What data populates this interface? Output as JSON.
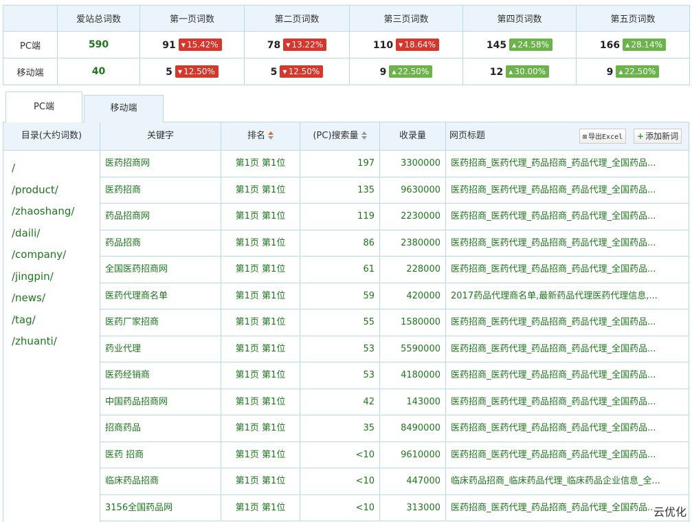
{
  "summary": {
    "headers": [
      "",
      "爱站总词数",
      "第一页词数",
      "第二页词数",
      "第三页词数",
      "第四页词数",
      "第五页词数"
    ],
    "rows": [
      {
        "label": "PC端",
        "total": "590",
        "pages": [
          {
            "count": "91",
            "change": "15.42%",
            "dir": "down"
          },
          {
            "count": "78",
            "change": "13.22%",
            "dir": "down"
          },
          {
            "count": "110",
            "change": "18.64%",
            "dir": "down"
          },
          {
            "count": "145",
            "change": "24.58%",
            "dir": "up"
          },
          {
            "count": "166",
            "change": "28.14%",
            "dir": "up"
          }
        ]
      },
      {
        "label": "移动端",
        "total": "40",
        "pages": [
          {
            "count": "5",
            "change": "12.50%",
            "dir": "down"
          },
          {
            "count": "5",
            "change": "12.50%",
            "dir": "down"
          },
          {
            "count": "9",
            "change": "22.50%",
            "dir": "up"
          },
          {
            "count": "12",
            "change": "30.00%",
            "dir": "up"
          },
          {
            "count": "9",
            "change": "22.50%",
            "dir": "up"
          }
        ]
      }
    ]
  },
  "tabs": {
    "pc": "PC端",
    "mobile": "移动端"
  },
  "table": {
    "headers": {
      "directory": "目录(大约词数)",
      "keyword": "关键字",
      "rank": "排名",
      "volume": "(PC)搜索量",
      "indexed": "收录量",
      "title": "网页标题"
    },
    "export_label": "导出Excel",
    "add_label": "添加新词",
    "directories": [
      "/",
      "/product/",
      "/zhaoshang/",
      "/daili/",
      "/company/",
      "/jingpin/",
      "/news/",
      "/tag/",
      "/zhuanti/"
    ],
    "rows": [
      {
        "keyword": "医药招商网",
        "rank": "第1页 第1位",
        "volume": "197",
        "indexed": "3300000",
        "title": "医药招商_医药代理_药品招商_药品代理_全国药品..."
      },
      {
        "keyword": "医药招商",
        "rank": "第1页 第1位",
        "volume": "135",
        "indexed": "9630000",
        "title": "医药招商_医药代理_药品招商_药品代理_全国药品..."
      },
      {
        "keyword": "药品招商网",
        "rank": "第1页 第1位",
        "volume": "119",
        "indexed": "2230000",
        "title": "医药招商_医药代理_药品招商_药品代理_全国药品..."
      },
      {
        "keyword": "药品招商",
        "rank": "第1页 第1位",
        "volume": "86",
        "indexed": "2380000",
        "title": "医药招商_医药代理_药品招商_药品代理_全国药品..."
      },
      {
        "keyword": "全国医药招商网",
        "rank": "第1页 第1位",
        "volume": "61",
        "indexed": "228000",
        "title": "医药招商_医药代理_药品招商_药品代理_全国药品..."
      },
      {
        "keyword": "医药代理商名单",
        "rank": "第1页 第1位",
        "volume": "59",
        "indexed": "420000",
        "title": "2017药品代理商名单,最新药品代理医药代理信息,..."
      },
      {
        "keyword": "医药厂家招商",
        "rank": "第1页 第1位",
        "volume": "55",
        "indexed": "1580000",
        "title": "医药招商_医药代理_药品招商_药品代理_全国药品..."
      },
      {
        "keyword": "药业代理",
        "rank": "第1页 第1位",
        "volume": "53",
        "indexed": "5590000",
        "title": "医药招商_医药代理_药品招商_药品代理_全国药品..."
      },
      {
        "keyword": "医药经销商",
        "rank": "第1页 第1位",
        "volume": "53",
        "indexed": "4180000",
        "title": "医药招商_医药代理_药品招商_药品代理_全国药品..."
      },
      {
        "keyword": "中国药品招商网",
        "rank": "第1页 第1位",
        "volume": "42",
        "indexed": "143000",
        "title": "医药招商_医药代理_药品招商_药品代理_全国药品..."
      },
      {
        "keyword": "招商药品",
        "rank": "第1页 第1位",
        "volume": "35",
        "indexed": "8490000",
        "title": "医药招商_医药代理_药品招商_药品代理_全国药品..."
      },
      {
        "keyword": "医药 招商",
        "rank": "第1页 第1位",
        "volume": "<10",
        "indexed": "9610000",
        "title": "医药招商_医药代理_药品招商_药品代理_全国药品..."
      },
      {
        "keyword": "临床药品招商",
        "rank": "第1页 第1位",
        "volume": "<10",
        "indexed": "447000",
        "title": "临床药品招商_临床药品代理_临床药品企业信息_全..."
      },
      {
        "keyword": "3156全国药品网",
        "rank": "第1页 第1位",
        "volume": "<10",
        "indexed": "313000",
        "title": "医药招商_医药代理_药品招商_药品代理_全国药品..."
      }
    ]
  },
  "watermark": "云优化"
}
